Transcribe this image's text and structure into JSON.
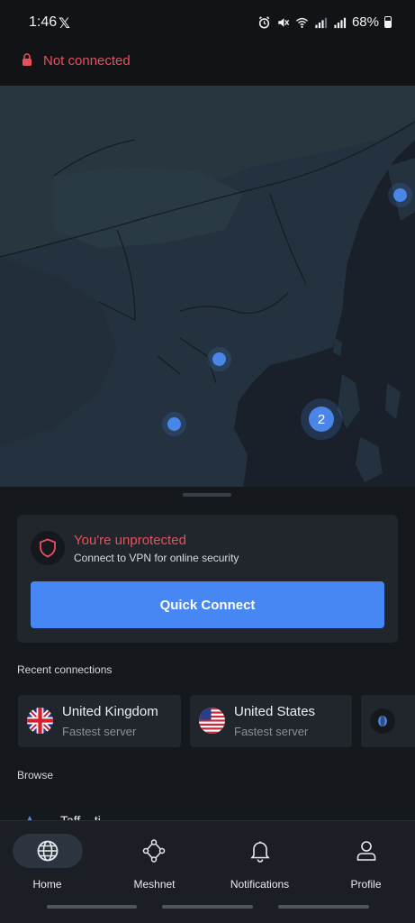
{
  "status_bar": {
    "time": "1:46",
    "x_logo": "𝕏",
    "battery": "68%"
  },
  "connection": {
    "status": "Not connected",
    "status_color": "#e8505b"
  },
  "map": {
    "cluster_count": "2"
  },
  "protection": {
    "title": "You're unprotected",
    "subtitle": "Connect to VPN for online security",
    "quick_connect_label": "Quick Connect"
  },
  "recent": {
    "label": "Recent connections",
    "items": [
      {
        "country": "United Kingdom",
        "server": "Fastest server",
        "flag": "uk-flag-icon"
      },
      {
        "country": "United States",
        "server": "Fastest server",
        "flag": "us-flag-icon"
      }
    ]
  },
  "browse": {
    "label": "Browse",
    "first_item": "Taff... ti..."
  },
  "nav": {
    "items": [
      {
        "label": "Home",
        "icon": "globe-icon",
        "active": true
      },
      {
        "label": "Meshnet",
        "icon": "meshnet-icon",
        "active": false
      },
      {
        "label": "Notifications",
        "icon": "bell-icon",
        "active": false
      },
      {
        "label": "Profile",
        "icon": "person-icon",
        "active": false
      }
    ]
  },
  "colors": {
    "accent": "#4687f4",
    "danger": "#e8505b",
    "background": "#15181d",
    "card": "#21252c"
  }
}
